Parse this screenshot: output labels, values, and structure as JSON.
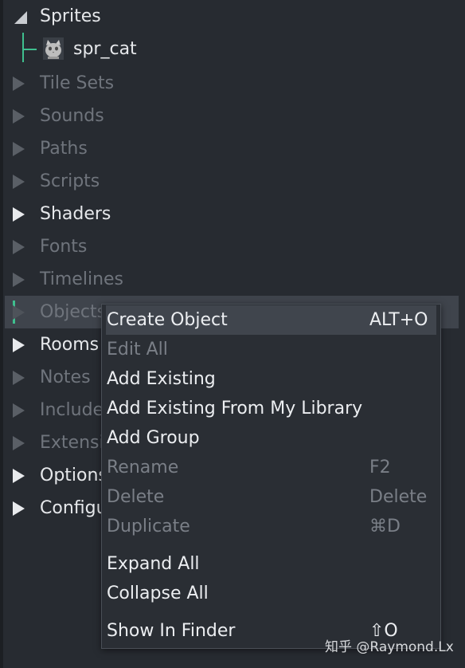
{
  "tree": {
    "items": [
      {
        "label": "Sprites"
      },
      {
        "label": "spr_cat"
      },
      {
        "label": "Tile Sets"
      },
      {
        "label": "Sounds"
      },
      {
        "label": "Paths"
      },
      {
        "label": "Scripts"
      },
      {
        "label": "Shaders"
      },
      {
        "label": "Fonts"
      },
      {
        "label": "Timelines"
      },
      {
        "label": "Objects"
      },
      {
        "label": "Rooms"
      },
      {
        "label": "Notes"
      },
      {
        "label": "Included Files"
      },
      {
        "label": "Extensions"
      },
      {
        "label": "Options"
      },
      {
        "label": "Configurations"
      }
    ]
  },
  "menu": {
    "items": [
      {
        "label": "Create Object",
        "shortcut": "ALT+O"
      },
      {
        "label": "Edit All",
        "shortcut": ""
      },
      {
        "label": "Add Existing",
        "shortcut": ""
      },
      {
        "label": "Add Existing From My Library",
        "shortcut": ""
      },
      {
        "label": "Add Group",
        "shortcut": ""
      },
      {
        "label": "Rename",
        "shortcut": "F2"
      },
      {
        "label": "Delete",
        "shortcut": "Delete"
      },
      {
        "label": "Duplicate",
        "shortcut": "⌘D"
      },
      {
        "label": "Expand All",
        "shortcut": ""
      },
      {
        "label": "Collapse All",
        "shortcut": ""
      },
      {
        "label": "Show In Finder",
        "shortcut": "⇧O"
      }
    ]
  },
  "watermark": {
    "text": "知乎 @Raymond.Lx"
  },
  "colors": {
    "accent": "#3fbf8f",
    "panel": "#272b31",
    "menu": "#2a2e34"
  }
}
